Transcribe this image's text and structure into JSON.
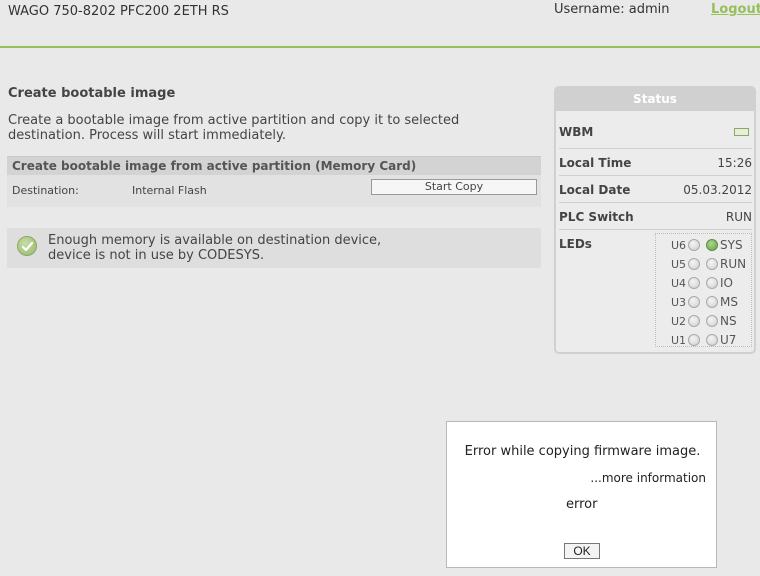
{
  "header": {
    "device_title": "WAGO 750-8202 PFC200 2ETH RS",
    "username": "Username: admin",
    "logout": "Logout"
  },
  "main": {
    "title": "Create bootable image",
    "description": "Create a bootable image from active partition and copy it to selected destination. Process will start immediately.",
    "section": {
      "heading": "Create bootable image from active partition (Memory Card)",
      "destination_label": "Destination:",
      "destination_value": "Internal Flash",
      "start_button": "Start Copy"
    },
    "notice": {
      "line1": "Enough memory is available on destination device,",
      "line2": "device is not in use by CODESYS."
    }
  },
  "status": {
    "title": "Status",
    "wbm_label": "WBM",
    "local_time_label": "Local Time",
    "local_time": "15:26",
    "local_date_label": "Local Date",
    "local_date": "05.03.2012",
    "plc_switch_label": "PLC Switch",
    "plc_switch": "RUN",
    "leds_label": "LEDs",
    "leds": [
      {
        "left": "U6",
        "right": "SYS",
        "right_on": true
      },
      {
        "left": "U5",
        "right": "RUN",
        "right_on": false
      },
      {
        "left": "U4",
        "right": "IO",
        "right_on": false
      },
      {
        "left": "U3",
        "right": "MS",
        "right_on": false
      },
      {
        "left": "U2",
        "right": "NS",
        "right_on": false
      },
      {
        "left": "U1",
        "right": "U7",
        "right_on": false
      }
    ]
  },
  "dialog": {
    "message": "Error while copying firmware image.",
    "more_info": "...more information",
    "error_text": "error",
    "ok_label": "OK"
  },
  "colors": {
    "accent": "#97bf5a",
    "led_on": "#67a24a"
  }
}
